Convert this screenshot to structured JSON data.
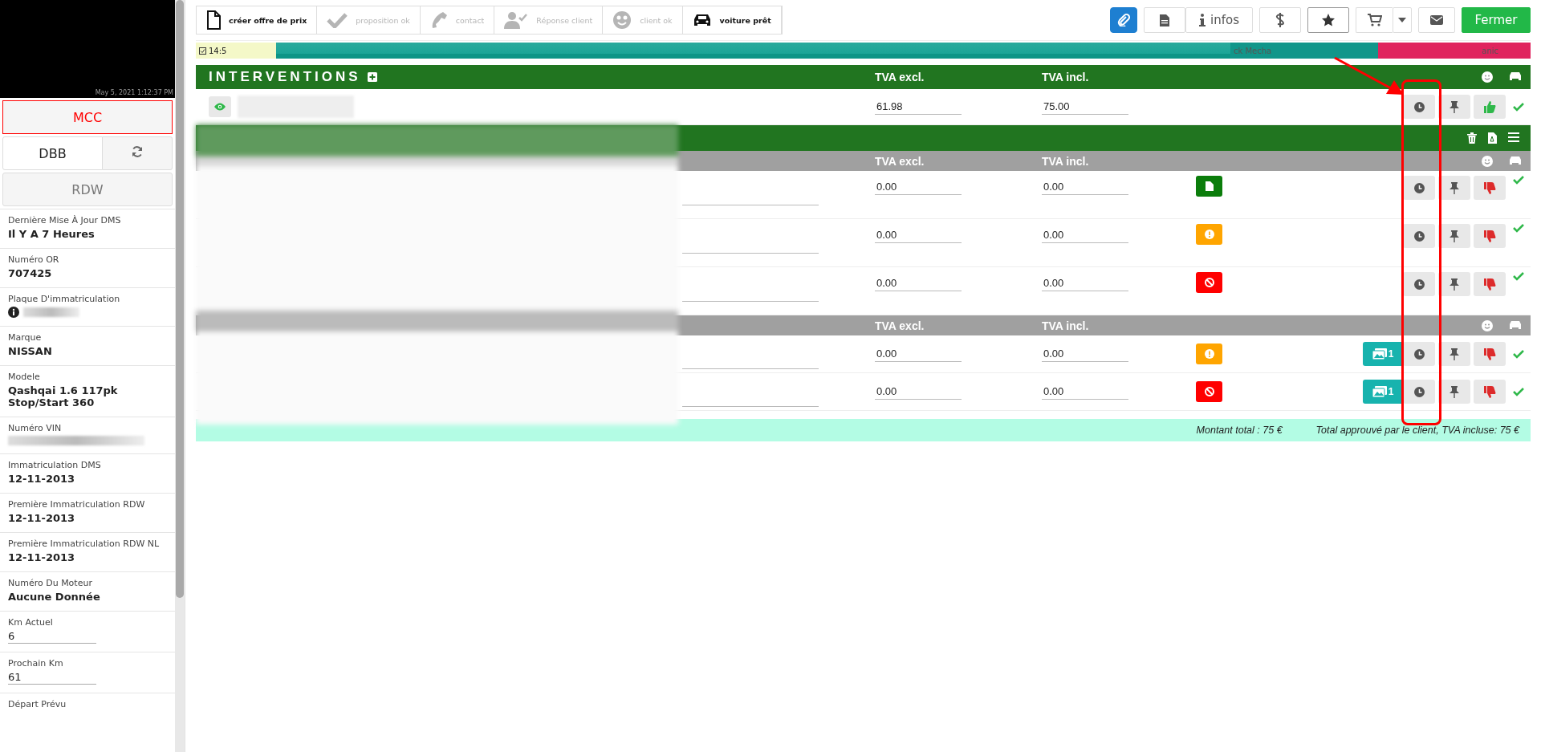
{
  "sidebar": {
    "video": {
      "timestamp": "May 5, 2021 1:12:37 PM"
    },
    "buttons": [
      {
        "label": "MCC",
        "kind": "alert"
      },
      {
        "label": "DBB",
        "kind": "plain"
      },
      {
        "label": "RDW",
        "kind": "muted"
      }
    ],
    "fields": [
      {
        "label": "Dernière Mise À Jour DMS",
        "value": "Il Y A 7 Heures",
        "kind": "text"
      },
      {
        "label": "Numéro OR",
        "value": "707425",
        "kind": "text"
      },
      {
        "label": "Plaque D'immatriculation",
        "kind": "info-redacted"
      },
      {
        "label": "Marque",
        "value": "NISSAN",
        "kind": "text"
      },
      {
        "label": "Modele",
        "value": "Qashqai 1.6 117pk Stop/Start 360",
        "kind": "text"
      },
      {
        "label": "Numéro VIN",
        "kind": "redacted"
      },
      {
        "label": "Immatriculation DMS",
        "value": "12-11-2013",
        "kind": "text"
      },
      {
        "label": "Première Immatriculation RDW",
        "value": "12-11-2013",
        "kind": "text"
      },
      {
        "label": "Première Immatriculation RDW NL",
        "value": "12-11-2013",
        "kind": "text"
      },
      {
        "label": "Numéro Du Moteur",
        "value": "Aucune Donnée",
        "kind": "text"
      },
      {
        "label": "Km Actuel",
        "value": "6",
        "kind": "input"
      },
      {
        "label": "Prochain Km",
        "value": "61",
        "kind": "input"
      },
      {
        "label": "Départ Prévu",
        "kind": "text"
      }
    ]
  },
  "steps": [
    {
      "label": "créer offre de prix",
      "kind": "document",
      "active": true
    },
    {
      "label": "proposition ok",
      "kind": "check",
      "active": false
    },
    {
      "label": "contact",
      "kind": "phone",
      "active": false
    },
    {
      "label": "Réponse client",
      "kind": "user-check",
      "active": false
    },
    {
      "label": "client ok",
      "kind": "smiley",
      "active": false
    },
    {
      "label": "voiture prêt",
      "kind": "car",
      "active": true
    }
  ],
  "toolbar": [
    {
      "kind": "attach",
      "selected": false
    },
    {
      "kind": "document",
      "selected": false
    },
    {
      "kind": "infos",
      "label": "infos",
      "selected": false
    },
    {
      "kind": "dollar",
      "selected": false
    },
    {
      "kind": "star",
      "selected": true
    },
    {
      "kind": "cart",
      "selected": false
    },
    {
      "kind": "caret",
      "selected": false
    },
    {
      "kind": "mail",
      "selected": false
    },
    {
      "kind": "close",
      "label": "Fermer",
      "selected": false
    }
  ],
  "timeline": {
    "time": "14:5",
    "segments": [
      {
        "label": "ck Mecha",
        "color": "#11968a"
      },
      {
        "label": "anic",
        "color": "#e0245e"
      }
    ]
  },
  "interventions": {
    "title": "INTERVENTIONS",
    "columns": [
      "TVA excl.",
      "TVA incl."
    ],
    "row": {
      "excl": "61.98",
      "incl": "75.00",
      "approved": true
    },
    "groups": [
      {
        "columns": [
          "TVA excl.",
          "TVA incl."
        ],
        "rows": [
          {
            "excl": "0.00",
            "incl": "0.00",
            "kind": "document",
            "approved": false
          },
          {
            "excl": "0.00",
            "incl": "0.00",
            "kind": "warning",
            "approved": false
          },
          {
            "excl": "0.00",
            "incl": "0.00",
            "kind": "blocked",
            "approved": false
          }
        ]
      },
      {
        "columns": [
          "TVA excl.",
          "TVA incl."
        ],
        "rows": [
          {
            "excl": "0.00",
            "incl": "0.00",
            "kind": "warning",
            "photos": "1",
            "approved": false
          },
          {
            "excl": "0.00",
            "incl": "0.00",
            "kind": "blocked",
            "photos": "1",
            "approved": false
          }
        ]
      }
    ],
    "total": "Montant total : 75 €",
    "approved_total": "Total approuvé par le client, TVA incluse: 75 €"
  }
}
